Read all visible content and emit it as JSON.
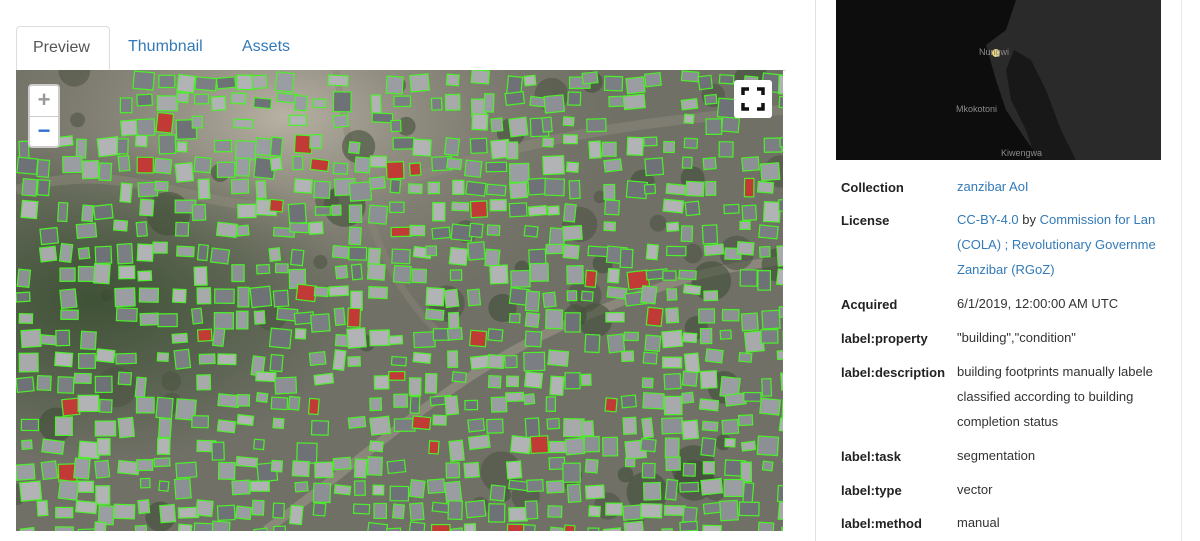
{
  "tabs": [
    {
      "label": "Preview",
      "active": true
    },
    {
      "label": "Thumbnail",
      "active": false
    },
    {
      "label": "Assets",
      "active": false
    }
  ],
  "map": {
    "zoom_in_label": "+",
    "zoom_out_label": "−",
    "fullscreen_icon": "fullscreen-icon"
  },
  "minimap": {
    "labels": [
      "Nungwi",
      "Mkokotoni",
      "Kiwengwa"
    ]
  },
  "metadata": {
    "collection": {
      "key": "Collection",
      "value": "zanzibar AoI"
    },
    "license": {
      "key": "License",
      "license_name": "CC-BY-4.0",
      "by_text": " by ",
      "org1": "Commission for Lan",
      "org1_line2": "(COLA) ; Revolutionary Governme",
      "org2_line3": "Zanzibar (RGoZ)"
    },
    "acquired": {
      "key": "Acquired",
      "value": "6/1/2019, 12:00:00 AM UTC"
    },
    "property": {
      "key": "label:property",
      "value": "\"building\",\"condition\""
    },
    "description": {
      "key": "label:description",
      "lines": [
        "building footprints manually labele",
        "classified according to building",
        "completion status"
      ]
    },
    "task": {
      "key": "label:task",
      "value": "segmentation"
    },
    "type": {
      "key": "label:type",
      "value": "vector"
    },
    "method": {
      "key": "label:method",
      "value": "manual"
    }
  },
  "colors": {
    "link": "#337ab7",
    "footprint_outline": "#4cf02a",
    "red_roof": "#c23a35"
  }
}
